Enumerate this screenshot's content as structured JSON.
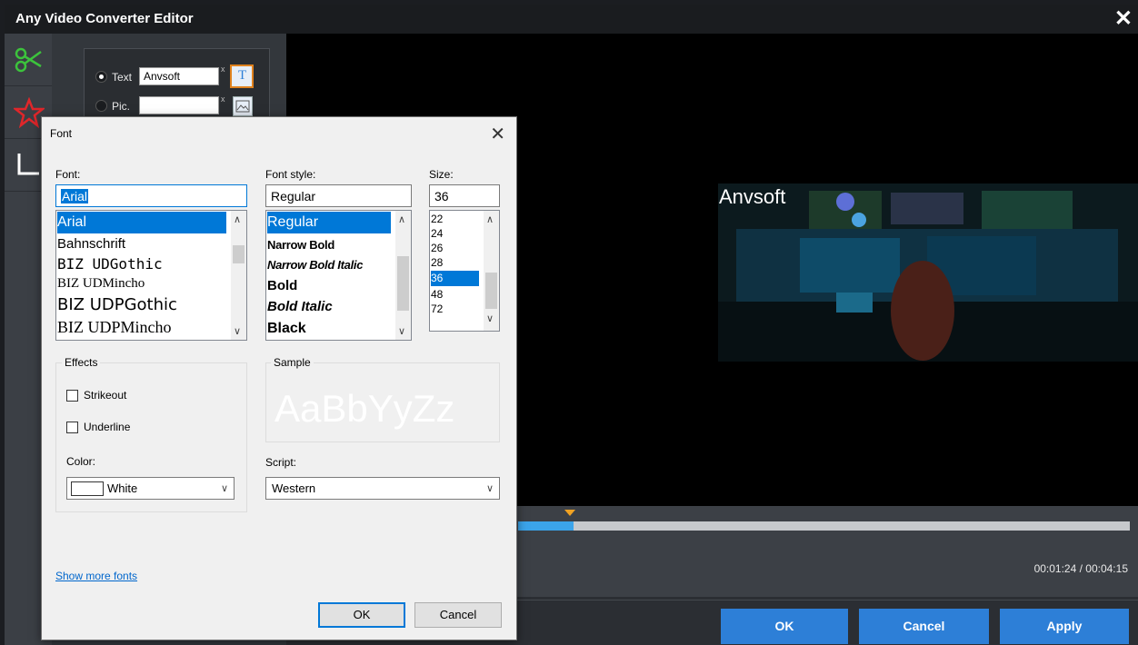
{
  "app": {
    "title": "Any Video Converter Editor"
  },
  "watermark": {
    "text_option": "Text",
    "text_value": "Anvsoft",
    "pic_option": "Pic.",
    "pic_value": "",
    "clear_glyph": "x"
  },
  "preview": {
    "overlay_text": "Anvsoft"
  },
  "timeline": {
    "time": "00:01:24 / 00:04:15",
    "progress": 0.09
  },
  "buttons": {
    "ok": "OK",
    "cancel": "Cancel",
    "apply": "Apply"
  },
  "font_dialog": {
    "title": "Font",
    "font_label": "Font:",
    "font_value": "Arial",
    "fonts": [
      "Arial",
      "Bahnschrift",
      "BIZ UDGothic",
      "BIZ UDMincho",
      "BIZ UDPGothic",
      "BIZ UDPMincho"
    ],
    "style_label": "Font style:",
    "style_value": "Regular",
    "styles": [
      "Regular",
      "Narrow Bold",
      "Narrow Bold Italic",
      "Bold",
      "Bold Italic",
      "Black"
    ],
    "size_label": "Size:",
    "size_value": "36",
    "sizes": [
      "22",
      "24",
      "26",
      "28",
      "36",
      "48",
      "72"
    ],
    "effects_label": "Effects",
    "strikeout_label": "Strikeout",
    "underline_label": "Underline",
    "color_label": "Color:",
    "color_value": "White",
    "sample_label": "Sample",
    "sample_text": "AaBbYyZz",
    "script_label": "Script:",
    "script_value": "Western",
    "show_more_fonts": "Show more fonts",
    "ok_label": "OK",
    "cancel_label": "Cancel"
  },
  "colors": {
    "accent_blue": "#2d7fd7",
    "selection_blue": "#0078d7",
    "marker_orange": "#f0a223"
  }
}
